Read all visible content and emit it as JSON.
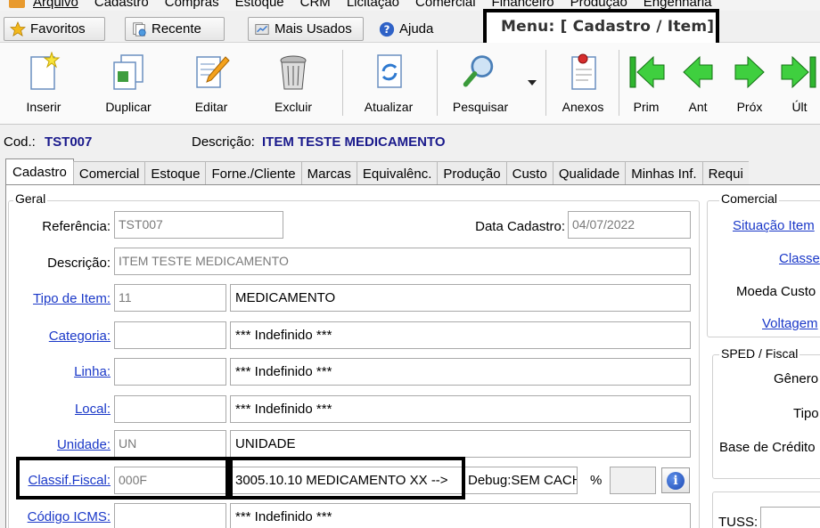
{
  "menubar": {
    "items": [
      "Arquivo",
      "Cadastro",
      "Compras",
      "Estoque",
      "CRM",
      "Licitação",
      "Comercial",
      "Financeiro",
      "Produção",
      "Engenharia"
    ]
  },
  "quickbar": {
    "favoritos": "Favoritos",
    "recente": "Recente",
    "mais_usados": "Mais Usados",
    "ajuda": "Ajuda",
    "menu_label": "Menu: [ Cadastro / Item]"
  },
  "toolbar": {
    "inserir": "Inserir",
    "duplicar": "Duplicar",
    "editar": "Editar",
    "excluir": "Excluir",
    "atualizar": "Atualizar",
    "pesquisar": "Pesquisar",
    "anexos": "Anexos",
    "prim": "Prim",
    "ant": "Ant",
    "prox": "Próx",
    "ult": "Últ"
  },
  "record": {
    "cod_label": "Cod.:",
    "cod_value": "TST007",
    "desc_label": "Descrição:",
    "desc_value": "ITEM TESTE MEDICAMENTO"
  },
  "tabs": [
    "Cadastro",
    "Comercial",
    "Estoque",
    "Forne./Cliente",
    "Marcas",
    "Equivalênc.",
    "Produção",
    "Custo",
    "Qualidade",
    "Minhas Inf.",
    "Requi"
  ],
  "geral": {
    "title": "Geral",
    "referencia_label": "Referência:",
    "referencia_value": "TST007",
    "data_cadastro_label": "Data Cadastro:",
    "data_cadastro_value": "04/07/2022",
    "descricao_label": "Descrição:",
    "descricao_value": "ITEM TESTE MEDICAMENTO",
    "tipo_item_label": "Tipo de Item:",
    "tipo_item_code": "11",
    "tipo_item_desc": "MEDICAMENTO",
    "categoria_label": "Categoria:",
    "categoria_code": "",
    "categoria_desc": "*** Indefinido ***",
    "linha_label": "Linha:",
    "linha_code": "",
    "linha_desc": "*** Indefinido ***",
    "local_label": "Local:",
    "local_code": "",
    "local_desc": "*** Indefinido ***",
    "unidade_label": "Unidade:",
    "unidade_code": "UN",
    "unidade_desc": "UNIDADE",
    "classif_label": "Classif.Fiscal:",
    "classif_code": "000F",
    "classif_desc": "3005.10.10 MEDICAMENTO XX   -->",
    "classif_debug": "Debug:SEM CACH",
    "percent_label": "%",
    "percent_value": "",
    "codigo_icms_label": "Código ICMS:",
    "codigo_icms_code": "",
    "codigo_icms_desc": "*** Indefinido ***"
  },
  "comercial": {
    "title": "Comercial",
    "situacao_item": "Situação Item",
    "classe": "Classe",
    "moeda_custo": "Moeda Custo",
    "voltagem": "Voltagem"
  },
  "sped": {
    "title": "SPED / Fiscal",
    "genero": "Gênero",
    "tipo": "Tipo",
    "base_credito": "Base de Crédito"
  },
  "tuss": {
    "label": "TUSS:"
  }
}
